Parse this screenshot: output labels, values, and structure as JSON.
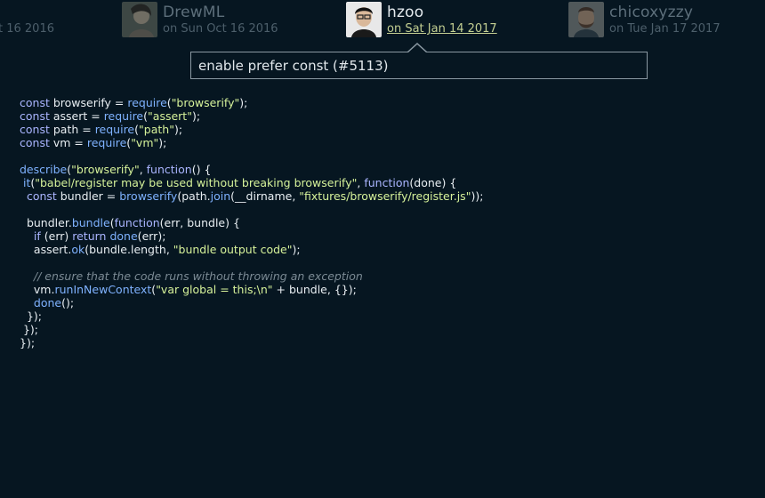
{
  "timeline": {
    "partial_date": "t 16 2016",
    "commits": [
      {
        "name": "DrewML",
        "date": "on Sun Oct 16 2016",
        "active": false
      },
      {
        "name": "hzoo",
        "date": "on Sat Jan 14 2017",
        "active": true
      },
      {
        "name": "chicoxyzzy",
        "date": "on Tue Jan 17 2017",
        "active": false
      }
    ]
  },
  "tooltip": {
    "message": "enable prefer const (#5113)"
  },
  "code": {
    "lines": [
      "const browserify = require(\"browserify\");",
      "const assert = require(\"assert\");",
      "const path = require(\"path\");",
      "const vm = require(\"vm\");",
      "",
      "describe(\"browserify\", function() {",
      " it(\"babel/register may be used without breaking browserify\", function(done) {",
      "  const bundler = browserify(path.join(__dirname, \"fixtures/browserify/register.js\"));",
      "",
      "  bundler.bundle(function(err, bundle) {",
      "    if (err) return done(err);",
      "    assert.ok(bundle.length, \"bundle output code\");",
      "",
      "    // ensure that the code runs without throwing an exception",
      "    vm.runInNewContext(\"var global = this;\\n\" + bundle, {});",
      "    done();",
      "  });",
      " });",
      "});"
    ]
  },
  "colors": {
    "background": "#061621",
    "keyword": "#aab5ff",
    "function": "#7fb2ff",
    "string": "#d6f29a",
    "comment": "#7b8a94",
    "active_date": "#c3cf92"
  }
}
